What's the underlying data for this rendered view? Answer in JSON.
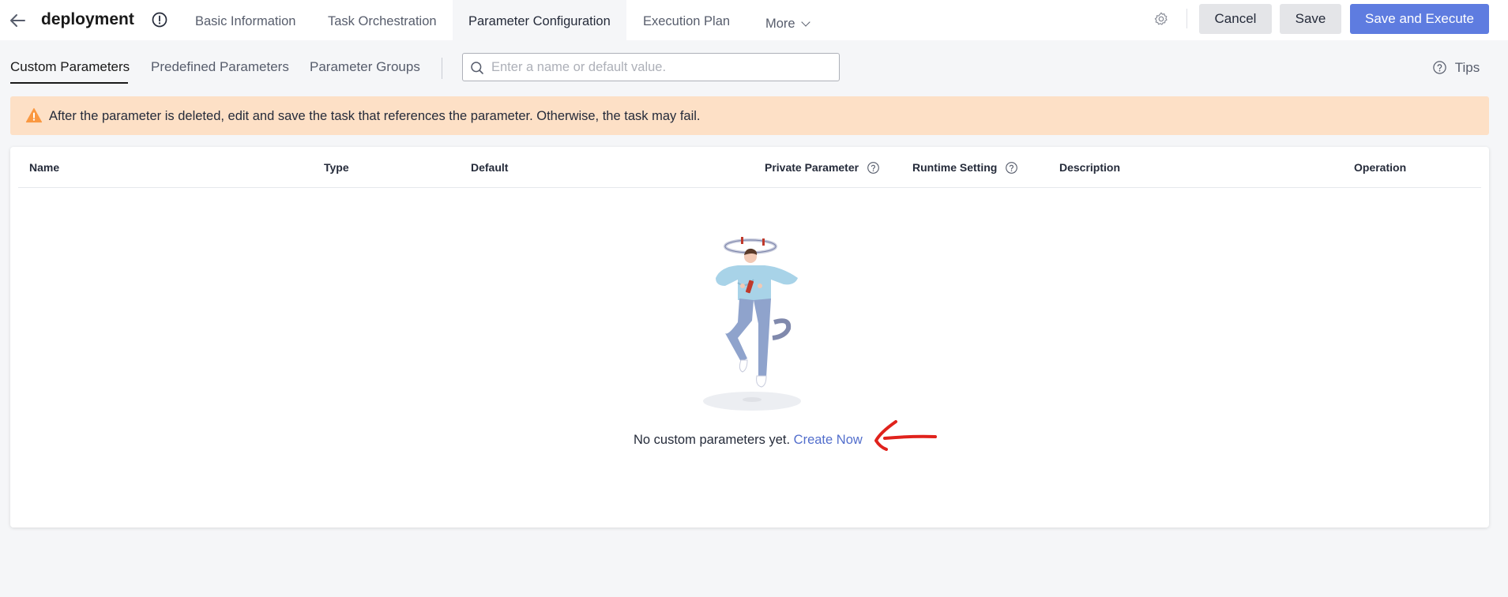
{
  "header": {
    "title": "deployment",
    "tabs": [
      {
        "label": "Basic Information"
      },
      {
        "label": "Task Orchestration"
      },
      {
        "label": "Parameter Configuration"
      },
      {
        "label": "Execution Plan"
      },
      {
        "label": "More"
      }
    ],
    "active_tab": "Parameter Configuration",
    "buttons": {
      "cancel": "Cancel",
      "save": "Save",
      "save_execute": "Save and Execute"
    }
  },
  "subtabs": [
    {
      "label": "Custom Parameters"
    },
    {
      "label": "Predefined Parameters"
    },
    {
      "label": "Parameter Groups"
    }
  ],
  "active_subtab": "Custom Parameters",
  "search": {
    "placeholder": "Enter a name or default value.",
    "value": ""
  },
  "tips_label": "Tips",
  "alert": {
    "text": "After the parameter is deleted, edit and save the task that references the parameter. Otherwise, the task may fail."
  },
  "table": {
    "columns": [
      "Name",
      "Type",
      "Default",
      "Private Parameter",
      "Runtime Setting",
      "Description",
      "Operation"
    ],
    "rows": []
  },
  "empty_state": {
    "text": "No custom parameters yet.",
    "link": "Create Now"
  },
  "colors": {
    "primary": "#5e7ce0",
    "link": "#526ecc",
    "alert_bg": "#fde0c6",
    "warning": "#fa9841",
    "annotation": "#e0221c"
  },
  "icons": [
    "back-arrow-icon",
    "info-icon",
    "chevron-down-icon",
    "gear-icon",
    "search-icon",
    "help-icon",
    "warning-icon"
  ]
}
